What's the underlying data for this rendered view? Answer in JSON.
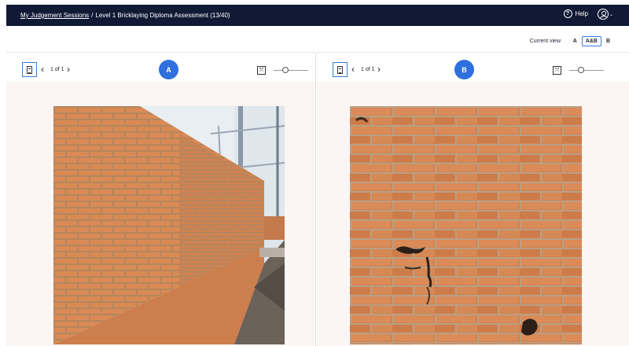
{
  "topbar": {
    "breadcrumb_link": "My Judgement Sessions",
    "separator": "/",
    "breadcrumb_current": "Level 1 Bricklaying Diploma Assessment (13/40)",
    "help_label": "Help",
    "help_icon": "question-circle-icon",
    "user_icon": "user-avatar-icon",
    "user_menu_arrow": "⌄"
  },
  "viewbar": {
    "label": "Current view",
    "options": [
      "A",
      "A&B",
      "B"
    ],
    "selected": "A&B"
  },
  "panels": {
    "left": {
      "badge": "A",
      "page_indicator": "1 of 1",
      "prev_icon": "‹",
      "next_icon": "›",
      "zoom_level": 0.35,
      "image": "photo of a newly built red brick wall running along a corner with scaffolding in the background"
    },
    "right": {
      "badge": "B",
      "page_indicator": "1 of 1",
      "prev_icon": "‹",
      "next_icon": "›",
      "zoom_level": 0.35,
      "image": "close-up photo of an older weathered red brick wall with dark stains"
    }
  },
  "colors": {
    "topbar": "#101a35",
    "accent": "#2f6fde",
    "panel_bg": "#fbf5f3",
    "brick": "#d98a55"
  }
}
